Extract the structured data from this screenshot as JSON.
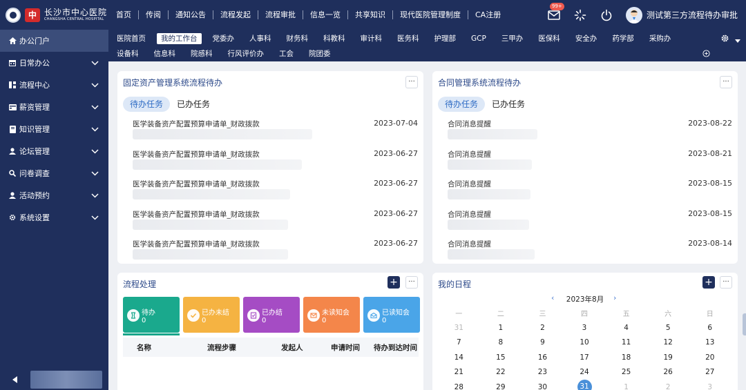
{
  "topnav": [
    "首页",
    "传阅",
    "通知公告",
    "流程发起",
    "流程审批",
    "信息一览",
    "共享知识",
    "现代医院管理制度",
    "CA注册"
  ],
  "header": {
    "badge": "99+",
    "user_name": "测试第三方流程待办审批"
  },
  "logo": {
    "cn": "长沙市中心医院",
    "en": "CHANGSHA CENTRAL HOSPITAL"
  },
  "sidebar": [
    {
      "label": "办公门户",
      "icon": "home-icon"
    },
    {
      "label": "日常办公",
      "icon": "calendar-icon"
    },
    {
      "label": "流程中心",
      "icon": "flow-icon"
    },
    {
      "label": "薪资管理",
      "icon": "card-icon"
    },
    {
      "label": "知识管理",
      "icon": "book-icon"
    },
    {
      "label": "论坛管理",
      "icon": "user-icon"
    },
    {
      "label": "问卷调查",
      "icon": "search-icon"
    },
    {
      "label": "活动预约",
      "icon": "user-icon"
    },
    {
      "label": "系统设置",
      "icon": "gear-icon"
    }
  ],
  "tabs_row1": [
    "医院首页",
    "我的工作台",
    "党委办",
    "人事科",
    "财务科",
    "科教科",
    "审计科",
    "医务科",
    "护理部",
    "GCP",
    "三甲办",
    "医保科",
    "安全办",
    "药学部",
    "采购办"
  ],
  "tabs_row2": [
    "设备科",
    "信息科",
    "院感科",
    "行风评价办",
    "工会",
    "院团委"
  ],
  "asset_panel": {
    "title": "固定资产管理系统流程待办",
    "tab_pending": "待办任务",
    "tab_done": "已办任务",
    "rows": [
      {
        "title": "医学装备资产配置预算申请单_财政拨款",
        "date": "2023-07-04"
      },
      {
        "title": "医学装备资产配置预算申请单_财政拨款",
        "date": "2023-06-27"
      },
      {
        "title": "医学装备资产配置预算申请单_财政拨款",
        "date": "2023-06-27"
      },
      {
        "title": "医学装备资产配置预算申请单_财政拨款",
        "date": "2023-06-27"
      },
      {
        "title": "医学装备资产配置预算申请单_财政拨款",
        "date": "2023-06-27"
      }
    ]
  },
  "contract_panel": {
    "title": "合同管理系统流程待办",
    "tab_pending": "待办任务",
    "tab_done": "已办任务",
    "rows": [
      {
        "title": "合同消息提醒",
        "date": "2023-08-22"
      },
      {
        "title": "合同消息提醒",
        "date": "2023-08-21"
      },
      {
        "title": "合同消息提醒",
        "date": "2023-08-15"
      },
      {
        "title": "合同消息提醒",
        "date": "2023-08-15"
      },
      {
        "title": "合同消息提醒",
        "date": "2023-08-14"
      }
    ]
  },
  "process_panel": {
    "title": "流程处理",
    "stats": [
      {
        "label": "待办",
        "value": "0",
        "color": "#1aa98d"
      },
      {
        "label": "已办未结",
        "value": "0",
        "color": "#f5b342"
      },
      {
        "label": "已办结",
        "value": "0",
        "color": "#a54cc4"
      },
      {
        "label": "未读知会",
        "value": "0",
        "color": "#f4864a"
      },
      {
        "label": "已读知会",
        "value": "0",
        "color": "#4aa5e8"
      }
    ],
    "columns": [
      "名称",
      "流程步骤",
      "发起人",
      "申请时间",
      "待办到达时间"
    ]
  },
  "calendar": {
    "title": "我的日程",
    "month_label": "2023年8月",
    "weekdays": [
      "一",
      "二",
      "三",
      "四",
      "五",
      "六",
      "日"
    ],
    "weeks": [
      [
        "31",
        "1",
        "2",
        "3",
        "4",
        "5",
        "6"
      ],
      [
        "7",
        "8",
        "9",
        "10",
        "11",
        "12",
        "13"
      ],
      [
        "14",
        "15",
        "16",
        "17",
        "18",
        "19",
        "20"
      ],
      [
        "21",
        "22",
        "23",
        "24",
        "25",
        "26",
        "27"
      ],
      [
        "28",
        "29",
        "30",
        "31",
        "1",
        "2",
        "3"
      ]
    ],
    "today": "31"
  }
}
